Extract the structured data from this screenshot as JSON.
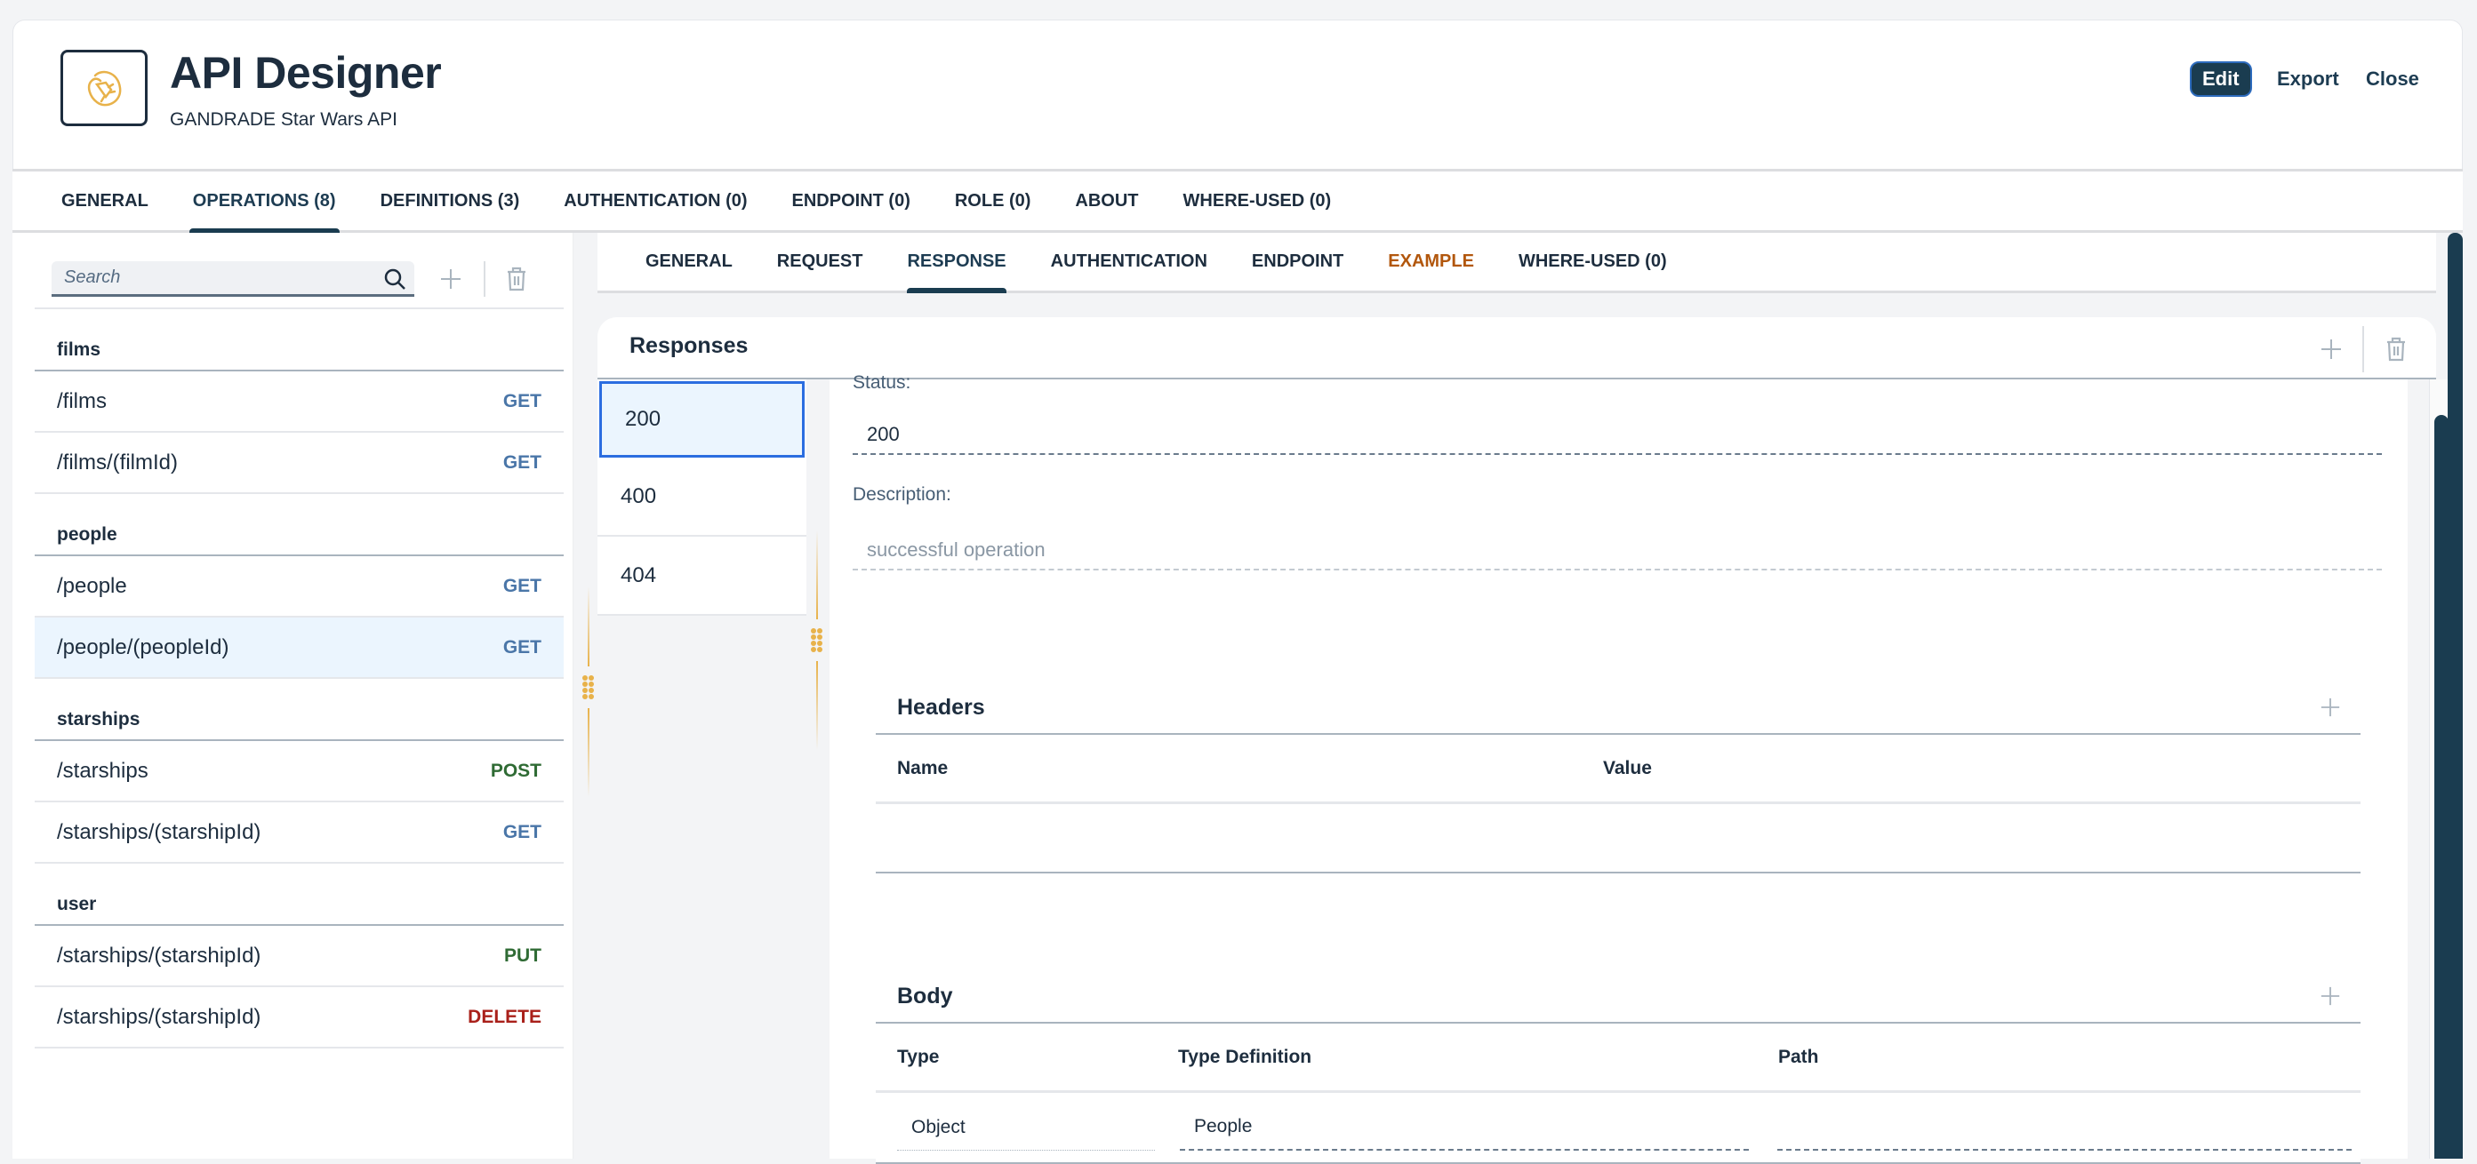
{
  "header": {
    "app_title": "API Designer",
    "subtitle": "GANDRADE Star Wars API",
    "logo_icon": "plug-circle-icon",
    "actions": {
      "edit": "Edit",
      "export": "Export",
      "close": "Close"
    }
  },
  "main_tabs": [
    {
      "label": "GENERAL",
      "active": false
    },
    {
      "label": "OPERATIONS (8)",
      "active": true
    },
    {
      "label": "DEFINITIONS (3)",
      "active": false
    },
    {
      "label": "AUTHENTICATION (0)",
      "active": false
    },
    {
      "label": "ENDPOINT (0)",
      "active": false
    },
    {
      "label": "ROLE (0)",
      "active": false
    },
    {
      "label": "ABOUT",
      "active": false
    },
    {
      "label": "WHERE-USED (0)",
      "active": false
    }
  ],
  "operations": {
    "search_placeholder": "Search",
    "groups": [
      {
        "name": "films",
        "items": [
          {
            "path": "/films",
            "method": "GET"
          },
          {
            "path": "/films/(filmId)",
            "method": "GET"
          }
        ]
      },
      {
        "name": "people",
        "items": [
          {
            "path": "/people",
            "method": "GET"
          },
          {
            "path": "/people/(peopleId)",
            "method": "GET",
            "selected": true
          }
        ]
      },
      {
        "name": "starships",
        "items": [
          {
            "path": "/starships",
            "method": "POST"
          },
          {
            "path": "/starships/(starshipId)",
            "method": "GET"
          }
        ]
      },
      {
        "name": "user",
        "items": [
          {
            "path": "/starships/(starshipId)",
            "method": "PUT"
          },
          {
            "path": "/starships/(starshipId)",
            "method": "DELETE"
          }
        ]
      }
    ]
  },
  "method_colors": {
    "GET": "#4a76a8",
    "POST": "#2f6b34",
    "PUT": "#2f6b34",
    "DELETE": "#a9201a"
  },
  "sub_tabs": [
    {
      "label": "GENERAL",
      "active": false
    },
    {
      "label": "REQUEST",
      "active": false
    },
    {
      "label": "RESPONSE",
      "active": true
    },
    {
      "label": "AUTHENTICATION",
      "active": false
    },
    {
      "label": "ENDPOINT",
      "active": false
    },
    {
      "label": "EXAMPLE",
      "active": false,
      "highlight": true
    },
    {
      "label": "WHERE-USED (0)",
      "active": false
    }
  ],
  "responses": {
    "title": "Responses",
    "codes": [
      "200",
      "400",
      "404"
    ],
    "selected": "200",
    "detail": {
      "status_label": "Status:",
      "status_value": "200",
      "description_label": "Description:",
      "description_value": "successful operation"
    },
    "headers": {
      "title": "Headers",
      "columns": [
        "Name",
        "Value"
      ],
      "rows": []
    },
    "body": {
      "title": "Body",
      "columns": [
        "Type",
        "Type Definition",
        "Path"
      ],
      "rows": [
        {
          "type": "Object",
          "type_definition": "People",
          "path": ""
        }
      ]
    }
  },
  "colors": {
    "primary": "#1a3c50",
    "accent": "#e8b24a",
    "example_tab": "#b2570d",
    "selection": "#ebf5fe"
  }
}
